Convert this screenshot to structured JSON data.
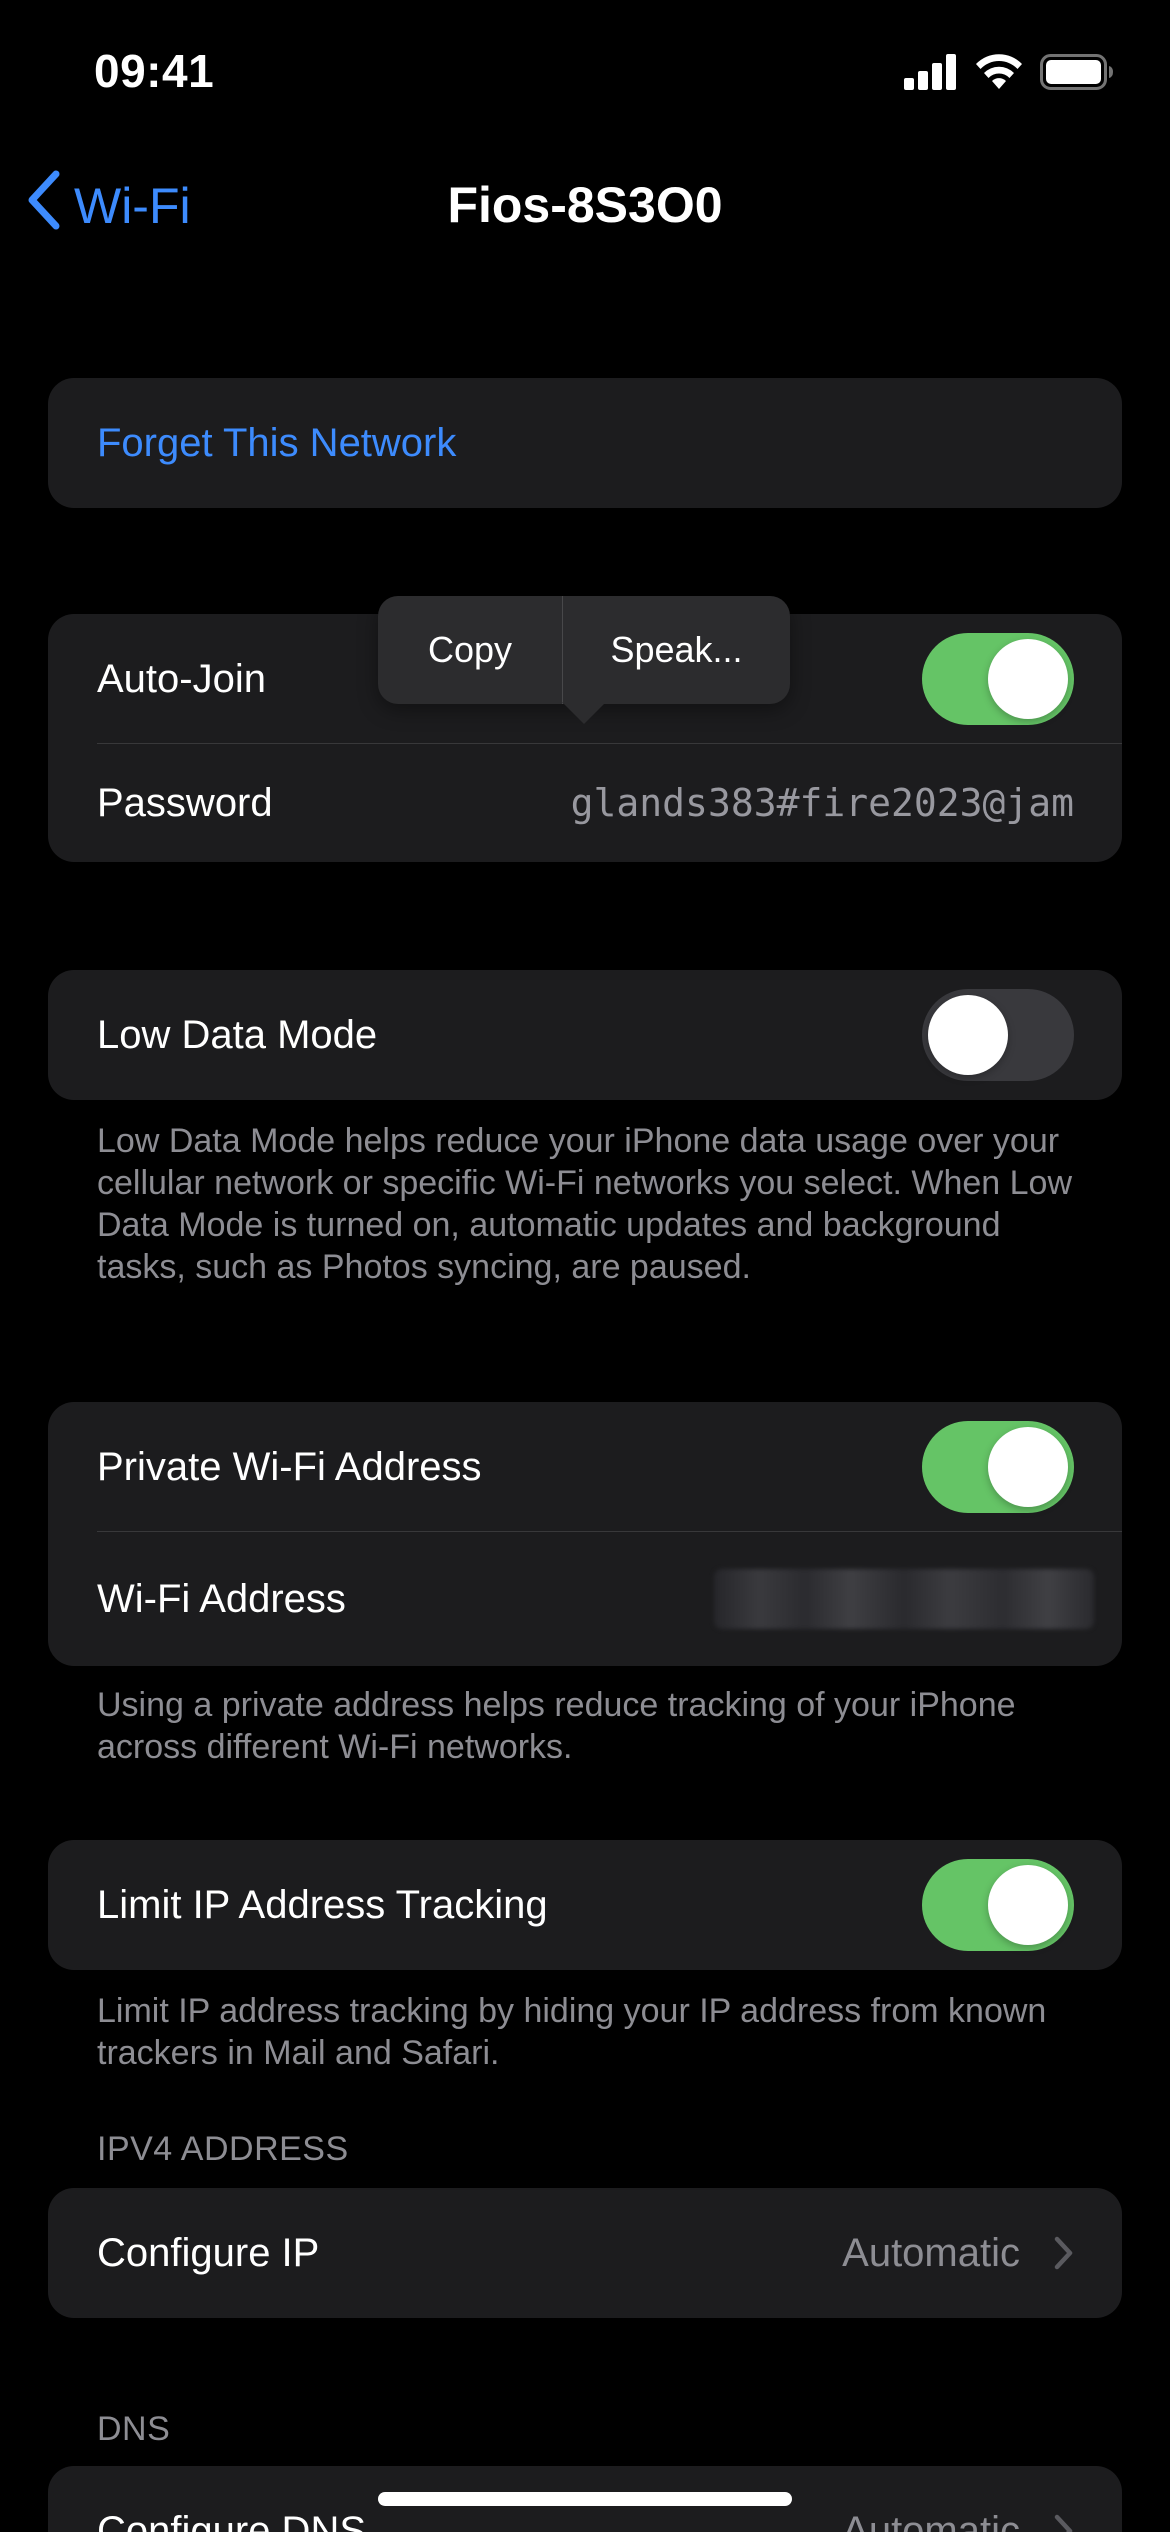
{
  "status_bar": {
    "time": "09:41",
    "icons": [
      "cellular-icon",
      "wifi-icon",
      "battery-icon"
    ]
  },
  "nav": {
    "back_label": "Wi-Fi",
    "title": "Fios-8S3O0"
  },
  "forget": {
    "label": "Forget This Network"
  },
  "popup": {
    "copy_label": "Copy",
    "speak_label": "Speak..."
  },
  "join_group": {
    "auto_join_label": "Auto-Join",
    "auto_join_on": true,
    "password_label": "Password",
    "password_value": "glands383#fire2023@jam"
  },
  "low_data": {
    "label": "Low Data Mode",
    "on": false,
    "footnote": "Low Data Mode helps reduce your iPhone data usage over your cellular network or specific Wi-Fi networks you select. When Low Data Mode is turned on, automatic updates and background tasks, such as Photos syncing, are paused."
  },
  "private_address": {
    "label": "Private Wi-Fi Address",
    "on": true,
    "address_label": "Wi-Fi Address",
    "footnote": "Using a private address helps reduce tracking of your iPhone across different Wi-Fi networks."
  },
  "limit_ip": {
    "label": "Limit IP Address Tracking",
    "on": true,
    "footnote": "Limit IP address tracking by hiding your IP address from known trackers in Mail and Safari."
  },
  "ipv4": {
    "header": "IPV4 ADDRESS",
    "configure_label": "Configure IP",
    "configure_value": "Automatic"
  },
  "dns": {
    "header": "DNS",
    "configure_label": "Configure DNS",
    "configure_value": "Automatic"
  },
  "colors": {
    "accent": "#3d8bfd",
    "toggle_on": "#65c466",
    "toggle_off": "#39393d",
    "cell_bg": "#1c1c1e",
    "secondary_text": "#8d8d93"
  }
}
